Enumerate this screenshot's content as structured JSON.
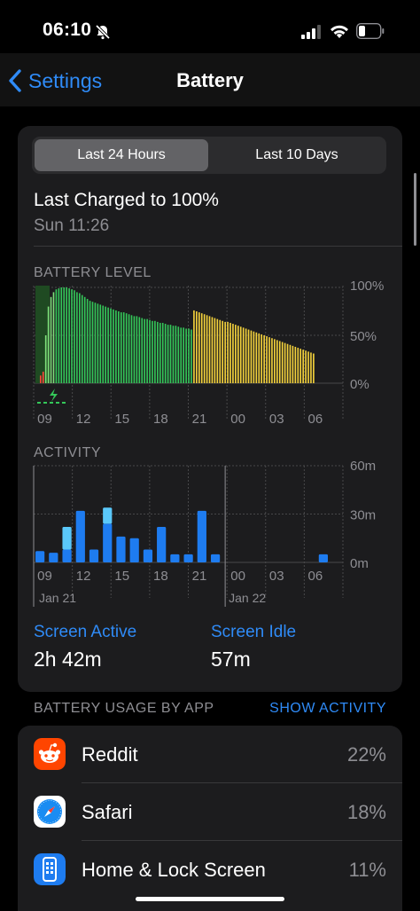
{
  "status": {
    "time": "06:10"
  },
  "nav": {
    "back_label": "Settings",
    "title": "Battery"
  },
  "segments": [
    {
      "label": "Last 24 Hours",
      "active": true
    },
    {
      "label": "Last 10 Days",
      "active": false
    }
  ],
  "last_charged": {
    "title": "Last Charged to 100%",
    "time": "Sun 11:26"
  },
  "colors": {
    "accent": "#2f8bf7",
    "battery_green": "#34c759",
    "battery_light_green": "#7ee07a",
    "battery_low_power": "#f5d33c",
    "battery_red": "#ff453a",
    "activity_blue": "#1e7cf0",
    "activity_light": "#5ac8fa"
  },
  "chart_data": [
    {
      "type": "bar",
      "title": "BATTERY LEVEL",
      "x_tick_labels": [
        "09",
        "12",
        "15",
        "18",
        "21",
        "00",
        "03",
        "06"
      ],
      "y_tick_labels": [
        "100%",
        "50%",
        "0%"
      ],
      "ylim": [
        0,
        100
      ],
      "unit": "%",
      "series": [
        {
          "color": "green",
          "values": [
            8,
            12,
            50,
            80,
            90,
            95,
            98,
            99,
            100,
            100,
            100,
            99,
            98,
            97,
            95,
            94,
            92,
            90,
            88,
            86,
            85,
            84,
            83,
            82,
            81,
            80,
            79,
            78,
            77,
            76,
            75,
            74,
            74,
            73,
            72,
            71,
            70,
            70,
            69,
            68,
            67,
            67,
            66,
            65,
            65,
            64,
            63,
            63,
            62,
            61,
            61,
            60,
            60,
            59,
            58,
            58,
            57,
            57,
            56
          ]
        },
        {
          "color": "yellow",
          "values": [
            76,
            75,
            74,
            73,
            72,
            71,
            70,
            69,
            68,
            67,
            66,
            65,
            64,
            64,
            63,
            62,
            61,
            60,
            59,
            58,
            57,
            56,
            55,
            54,
            53,
            52,
            51,
            50,
            49,
            48,
            47,
            46,
            45,
            44,
            43,
            42,
            41,
            40,
            39,
            38,
            37,
            36,
            35,
            34,
            33,
            32,
            31
          ]
        }
      ]
    },
    {
      "type": "bar",
      "title": "ACTIVITY",
      "x_tick_labels": [
        "09",
        "12",
        "15",
        "18",
        "21",
        "00",
        "03",
        "06"
      ],
      "date_labels": [
        "Jan 21",
        "Jan 22"
      ],
      "y_tick_labels": [
        "60m",
        "30m",
        "0m"
      ],
      "ylim": [
        0,
        60
      ],
      "unit": "min",
      "series": [
        {
          "name": "Screen Active",
          "values": [
            7,
            6,
            8,
            32,
            8,
            24,
            16,
            15,
            8,
            22,
            5,
            5,
            32,
            5,
            0,
            0,
            0,
            0,
            0,
            0,
            0,
            5
          ]
        },
        {
          "name": "Screen Idle",
          "values": [
            0,
            0,
            14,
            0,
            0,
            10,
            0,
            0,
            0,
            0,
            0,
            0,
            0,
            0,
            0,
            0,
            0,
            0,
            0,
            0,
            0,
            0
          ]
        }
      ]
    }
  ],
  "metrics": {
    "screen_active_label": "Screen Active",
    "screen_active_value": "2h 42m",
    "screen_idle_label": "Screen Idle",
    "screen_idle_value": "57m"
  },
  "usage": {
    "header": "BATTERY USAGE BY APP",
    "show_activity": "SHOW ACTIVITY"
  },
  "apps": [
    {
      "name": "Reddit",
      "percent": "22%",
      "icon": "reddit-icon"
    },
    {
      "name": "Safari",
      "percent": "18%",
      "icon": "safari-icon"
    },
    {
      "name": "Home & Lock Screen",
      "percent": "11%",
      "icon": "home-lock-screen-icon"
    }
  ]
}
